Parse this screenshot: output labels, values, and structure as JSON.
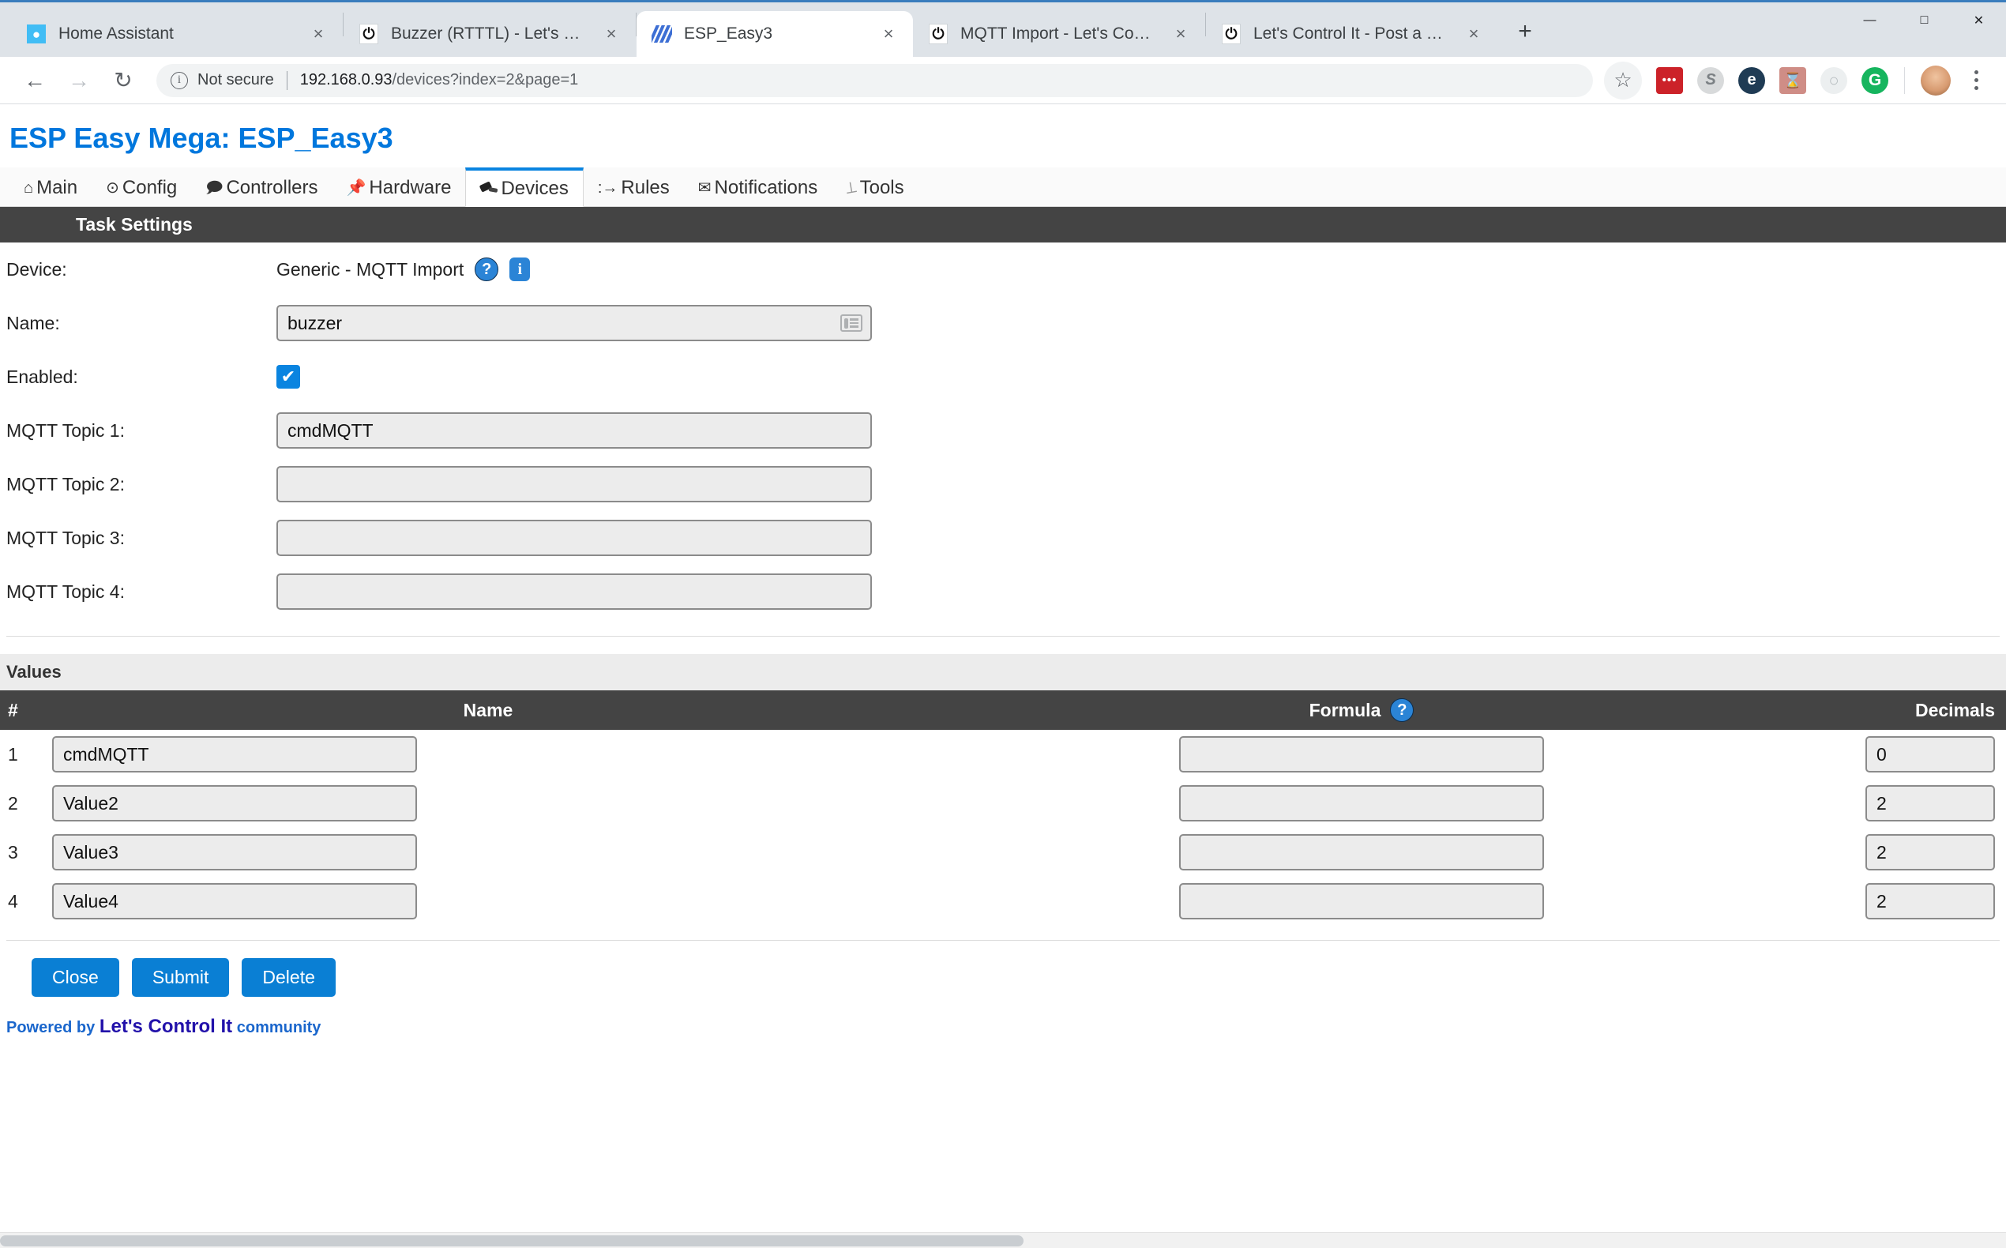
{
  "browser": {
    "tabs": [
      {
        "title": "Home Assistant",
        "favicon": "home-assistant-icon",
        "active": false,
        "close": "×"
      },
      {
        "title": "Buzzer (RTTTL) - Let's Control It",
        "favicon": "lets-control-it-icon",
        "active": false,
        "close": "×"
      },
      {
        "title": "ESP_Easy3",
        "favicon": "esp-easy-icon",
        "active": true,
        "close": "×"
      },
      {
        "title": "MQTT Import - Let's Control It",
        "favicon": "lets-control-it-icon",
        "active": false,
        "close": "×"
      },
      {
        "title": "Let's Control It - Post a new topic",
        "favicon": "lets-control-it-icon",
        "active": false,
        "close": "×"
      }
    ],
    "new_tab_label": "+",
    "window_controls": {
      "minimize": "—",
      "maximize": "□",
      "close": "✕"
    },
    "nav": {
      "back": "←",
      "forward": "→",
      "reload": "↻"
    },
    "omnibox": {
      "security_label": "Not secure",
      "url_host": "192.168.0.93",
      "url_path": "/devices?index=2&page=1",
      "info_icon": "i"
    },
    "actions": {
      "bookmark": "☆",
      "extensions": [
        {
          "name": "dots-extension-icon",
          "glyph": "•••"
        },
        {
          "name": "skype-extension-icon",
          "glyph": "S"
        },
        {
          "name": "e-extension-icon",
          "glyph": "e"
        },
        {
          "name": "adobe-pdf-extension-icon",
          "glyph": "Ⓐ"
        },
        {
          "name": "circle-extension-icon",
          "glyph": "○"
        },
        {
          "name": "grammarly-extension-icon",
          "glyph": "G"
        }
      ],
      "menu": "kebab-menu-icon"
    }
  },
  "app": {
    "title": "ESP Easy Mega: ESP_Easy3",
    "nav_tabs": [
      {
        "label": "Main",
        "icon": "⌂",
        "icon_name": "home-icon",
        "active": false
      },
      {
        "label": "Config",
        "icon": "⊙",
        "icon_name": "gear-icon",
        "active": false
      },
      {
        "label": "Controllers",
        "icon": "💬",
        "icon_name": "speech-bubble-icon",
        "active": false
      },
      {
        "label": "Hardware",
        "icon": "📌",
        "icon_name": "pin-icon",
        "active": false
      },
      {
        "label": "Devices",
        "icon": "plug",
        "icon_name": "plug-icon",
        "active": true
      },
      {
        "label": "Rules",
        "icon": ":→",
        "icon_name": "rules-icon",
        "active": false
      },
      {
        "label": "Notifications",
        "icon": "✉",
        "icon_name": "envelope-icon",
        "active": false
      },
      {
        "label": "Tools",
        "icon": "🔧",
        "icon_name": "wrench-icon",
        "active": false
      }
    ],
    "task_settings": {
      "header": "Task Settings",
      "device_label": "Device:",
      "device_value": "Generic - MQTT Import",
      "help_badge": "?",
      "info_badge": "i",
      "name_label": "Name:",
      "name_value": "buzzer",
      "name_autofill_icon": "contact-card-icon",
      "enabled_label": "Enabled:",
      "enabled_checked": true,
      "check_glyph": "✔",
      "topics": [
        {
          "label": "MQTT Topic 1:",
          "value": "cmdMQTT"
        },
        {
          "label": "MQTT Topic 2:",
          "value": ""
        },
        {
          "label": "MQTT Topic 3:",
          "value": ""
        },
        {
          "label": "MQTT Topic 4:",
          "value": ""
        }
      ]
    },
    "values": {
      "header": "Values",
      "columns": {
        "num": "#",
        "name": "Name",
        "formula": "Formula",
        "formula_help": "?",
        "decimals": "Decimals"
      },
      "rows": [
        {
          "num": "1",
          "name": "cmdMQTT",
          "formula": "",
          "decimals": "0"
        },
        {
          "num": "2",
          "name": "Value2",
          "formula": "",
          "decimals": "2"
        },
        {
          "num": "3",
          "name": "Value3",
          "formula": "",
          "decimals": "2"
        },
        {
          "num": "4",
          "name": "Value4",
          "formula": "",
          "decimals": "2"
        }
      ]
    },
    "buttons": {
      "close": "Close",
      "submit": "Submit",
      "delete": "Delete"
    },
    "footer": {
      "prefix": "Powered by ",
      "brand": "Let's Control It",
      "suffix": " community"
    },
    "colors": {
      "accent": "#0a7fd4",
      "title": "#0077dd",
      "header_bar": "#444444",
      "subsection_bar": "#ececec",
      "input_bg": "#ececec",
      "input_border": "#8b8b8b",
      "badge": "#2b84d6"
    }
  }
}
